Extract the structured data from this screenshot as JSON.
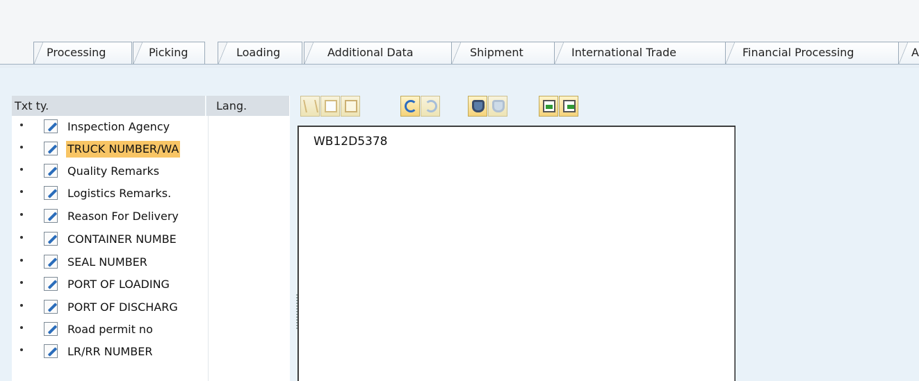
{
  "tabs": [
    {
      "label": "Processing"
    },
    {
      "label": "Picking"
    },
    {
      "label": "Loading"
    },
    {
      "label": "Additional Data"
    },
    {
      "label": "Shipment"
    },
    {
      "label": "International Trade"
    },
    {
      "label": "Financial Processing"
    },
    {
      "label": "A"
    }
  ],
  "text_tree": {
    "col_text_type": "Txt ty.",
    "col_language": "Lang.",
    "items": [
      {
        "label": "Inspection Agency",
        "icon": "edit-pen-icon"
      },
      {
        "label": "TRUCK NUMBER/WA",
        "icon": "edit-pen-icon",
        "selected": true
      },
      {
        "label": "Quality Remarks",
        "icon": "edit-pen-icon"
      },
      {
        "label": "Logistics Remarks.",
        "icon": "edit-pen-icon"
      },
      {
        "label": "Reason For Delivery",
        "icon": "edit-pen-icon"
      },
      {
        "label": "CONTAINER NUMBE",
        "icon": "edit-pen-icon"
      },
      {
        "label": "SEAL NUMBER",
        "icon": "edit-pen-icon"
      },
      {
        "label": "PORT OF LOADING",
        "icon": "edit-pen-icon"
      },
      {
        "label": "PORT OF DISCHARG",
        "icon": "edit-pen-icon"
      },
      {
        "label": "Road permit no",
        "icon": "edit-pen-icon"
      },
      {
        "label": "LR/RR NUMBER",
        "icon": "edit-pen-icon"
      }
    ]
  },
  "toolbar": {
    "buttons": [
      "cut-icon",
      "copy-icon",
      "paste-icon",
      "undo-icon",
      "redo-icon",
      "find-icon",
      "find-next-icon",
      "import-icon",
      "export-icon"
    ]
  },
  "editor": {
    "content": "WB12D5378"
  },
  "colors": {
    "selection_highlight": "#f8c565",
    "background": "#e9f2f9"
  }
}
